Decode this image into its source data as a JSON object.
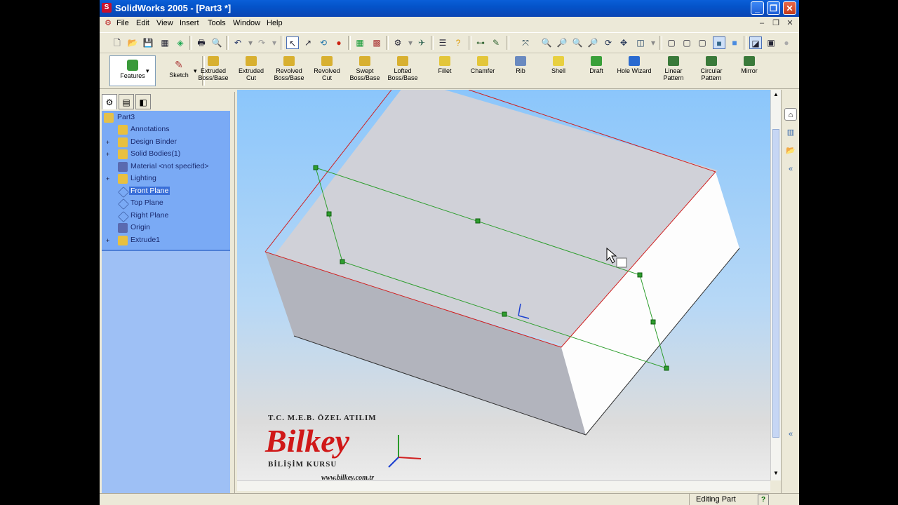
{
  "window": {
    "title": "SolidWorks 2005 - [Part3 *]",
    "controls": [
      "_",
      "❐",
      "✕"
    ]
  },
  "menu": [
    "File",
    "Edit",
    "View",
    "Insert",
    "Tools",
    "Window",
    "Help"
  ],
  "command_manager": {
    "control_tabs": [
      {
        "label": "Features"
      },
      {
        "label": "Sketch"
      }
    ],
    "buttons": [
      {
        "label": "Extruded\nBoss/Base",
        "icon": "extruded-boss-icon"
      },
      {
        "label": "Extruded\nCut",
        "icon": "extruded-cut-icon"
      },
      {
        "label": "Revolved\nBoss/Base",
        "icon": "revolved-boss-icon"
      },
      {
        "label": "Revolved\nCut",
        "icon": "revolved-cut-icon"
      },
      {
        "label": "Swept\nBoss/Base",
        "icon": "swept-boss-icon"
      },
      {
        "label": "Lofted\nBoss/Base",
        "icon": "lofted-boss-icon"
      },
      {
        "label": "Fillet",
        "icon": "fillet-icon"
      },
      {
        "label": "Chamfer",
        "icon": "chamfer-icon"
      },
      {
        "label": "Rib",
        "icon": "rib-icon"
      },
      {
        "label": "Shell",
        "icon": "shell-icon"
      },
      {
        "label": "Draft",
        "icon": "draft-icon"
      },
      {
        "label": "Hole Wizard",
        "icon": "hole-wizard-icon"
      },
      {
        "label": "Linear\nPattern",
        "icon": "linear-pattern-icon"
      },
      {
        "label": "Circular\nPattern",
        "icon": "circular-pattern-icon"
      },
      {
        "label": "Mirror",
        "icon": "mirror-icon"
      }
    ]
  },
  "feature_tree": {
    "root": "Part3",
    "nodes": [
      {
        "label": "Annotations",
        "expandable": false,
        "icon": "annotations-icon"
      },
      {
        "label": "Design Binder",
        "expandable": true,
        "icon": "design-binder-icon"
      },
      {
        "label": "Solid Bodies(1)",
        "expandable": true,
        "icon": "solid-bodies-icon"
      },
      {
        "label": "Material <not specified>",
        "expandable": false,
        "icon": "material-icon"
      },
      {
        "label": "Lighting",
        "expandable": true,
        "icon": "lighting-icon"
      },
      {
        "label": "Front Plane",
        "expandable": false,
        "icon": "plane-icon",
        "selected": true
      },
      {
        "label": "Top Plane",
        "expandable": false,
        "icon": "plane-icon"
      },
      {
        "label": "Right Plane",
        "expandable": false,
        "icon": "plane-icon"
      },
      {
        "label": "Origin",
        "expandable": false,
        "icon": "origin-icon"
      },
      {
        "label": "Extrude1",
        "expandable": true,
        "icon": "extrude-icon"
      }
    ]
  },
  "watermark": {
    "line1": "T.C. M.E.B. ÖZEL ATILIM",
    "brand": "Bilkey",
    "line3": "BİLİŞİM KURSU",
    "url": "www.bilkey.com.tr"
  },
  "status": {
    "text": "Editing Part",
    "help": "?"
  },
  "colors": {
    "tree_bg": "#7aaaf5",
    "selection_green": "#2e9e2e",
    "edge_red": "#e0202a"
  }
}
